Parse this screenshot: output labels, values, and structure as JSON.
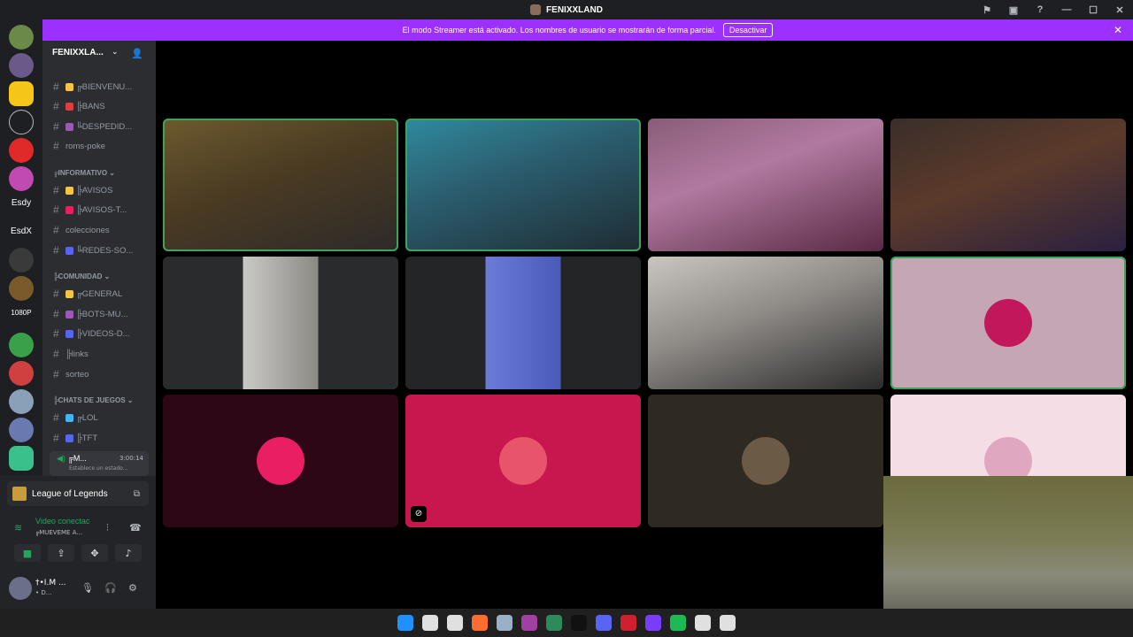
{
  "window": {
    "title": "FENIXXLAND"
  },
  "banner": {
    "text": "El modo Streamer está activado. Los nombres de usuario se mostrarán de forma parcial.",
    "button": "Desactivar"
  },
  "servers": {
    "text_items": [
      "Esdy",
      "EsdX",
      "1080P"
    ]
  },
  "guild": {
    "name": "FENIXXLA..."
  },
  "channels": [
    {
      "label": "╔BIENVENU...",
      "emoji_color": "#f5c542"
    },
    {
      "label": "╠BANS",
      "emoji_color": "#e03d3d"
    },
    {
      "label": "╚DESPEDID...",
      "emoji_color": "#9b59b6"
    },
    {
      "label": "roms-poke",
      "emoji_color": ""
    }
  ],
  "categories": {
    "informativo": "╔INFORMATIVO",
    "comunidad": "╠COMUNIDAD",
    "juegos": "╠CHATS DE JUEGOS"
  },
  "channels_info": [
    {
      "label": "╠AVISOS",
      "emoji_color": "#f5c542"
    },
    {
      "label": "╠AVISOS-T...",
      "emoji_color": "#e91e63"
    },
    {
      "label": "colecciones",
      "emoji_color": ""
    },
    {
      "label": "╚REDES-SO...",
      "emoji_color": "#5865f2"
    }
  ],
  "channels_comunidad": [
    {
      "label": "╔GENERAL",
      "emoji_color": "#f5c542"
    },
    {
      "label": "╠BOTS-MU...",
      "emoji_color": "#9b59b6"
    },
    {
      "label": "╠VIDEOS-D...",
      "emoji_color": "#5865f2"
    },
    {
      "label": "╠links",
      "emoji_color": ""
    },
    {
      "label": "sorteo",
      "emoji_color": ""
    }
  ],
  "channels_juegos": [
    {
      "label": "╔LOL",
      "emoji_color": "#3fb6ff"
    },
    {
      "label": "╠TFT",
      "emoji_color": "#5865f2"
    }
  ],
  "voice_channel": {
    "name": "╔M...",
    "time": "3:00:14",
    "status": "Establece un estado..."
  },
  "panel": {
    "activity": "League of Legends",
    "voice_status": "Video conectac",
    "voice_channel": "╔MUEVEME A...",
    "user_name": "†•I.M ...",
    "user_sub": "• D..."
  },
  "colors": {
    "accent": "#9b30ff",
    "speaking": "#3ba55d",
    "connected": "#23a55a"
  },
  "tiles": [
    {
      "bg": "linear-gradient(160deg,#6d5a2e 0%,#4a3b22 45%,#2e2a2a 100%)",
      "speaking": true,
      "avatar": ""
    },
    {
      "bg": "linear-gradient(160deg,#2f8a9e 0%,#2b5f70 40%,#1e2c33 100%)",
      "speaking": true,
      "avatar": ""
    },
    {
      "bg": "linear-gradient(160deg,#8a5c78 0%,#b07aa0 40%,#5a2a44 100%)",
      "speaking": false,
      "avatar": ""
    },
    {
      "bg": "linear-gradient(160deg,#3a2e2a 0%,#5b3a2a 45%,#2a2040 100%)",
      "speaking": false,
      "avatar": ""
    },
    {
      "bg": "linear-gradient(90deg,#2a2b2d 0%,#2a2b2d 34%,#c9c9c6 34%,#8c8984 66%,#2a2b2d 66%)",
      "speaking": false,
      "avatar": ""
    },
    {
      "bg": "linear-gradient(90deg,#242526 0%,#242526 34%,#6b7bd8 34%,#4a5ab8 66%,#242526 66%)",
      "speaking": false,
      "avatar": ""
    },
    {
      "bg": "linear-gradient(160deg,#c9c5bf 0%,#8e8a86 45%,#2b2b2b 100%)",
      "speaking": false,
      "avatar": ""
    },
    {
      "bg": "#c4a6b5",
      "speaking": true,
      "avatar": "#c2185b"
    },
    {
      "bg": "#2d0716",
      "speaking": false,
      "avatar": "#e91e63"
    },
    {
      "bg": "#c8174e",
      "speaking": false,
      "avatar": "#e8556a"
    },
    {
      "bg": "#2e2a21",
      "speaking": false,
      "avatar": "#6b5a45"
    },
    {
      "bg": "#f5dde6",
      "speaking": false,
      "avatar": "#e0a8c0"
    }
  ],
  "taskbar": {
    "icons": [
      "#1e90ff",
      "#e0e0e0",
      "#e0e0e0",
      "#ff6d2e",
      "#9ab0c8",
      "#a040a0",
      "#2e8a5a",
      "#111111",
      "#5865f2",
      "#d02030",
      "#7a3cff",
      "#1db954",
      "#e0e0e0",
      "#e0e0e0"
    ]
  }
}
